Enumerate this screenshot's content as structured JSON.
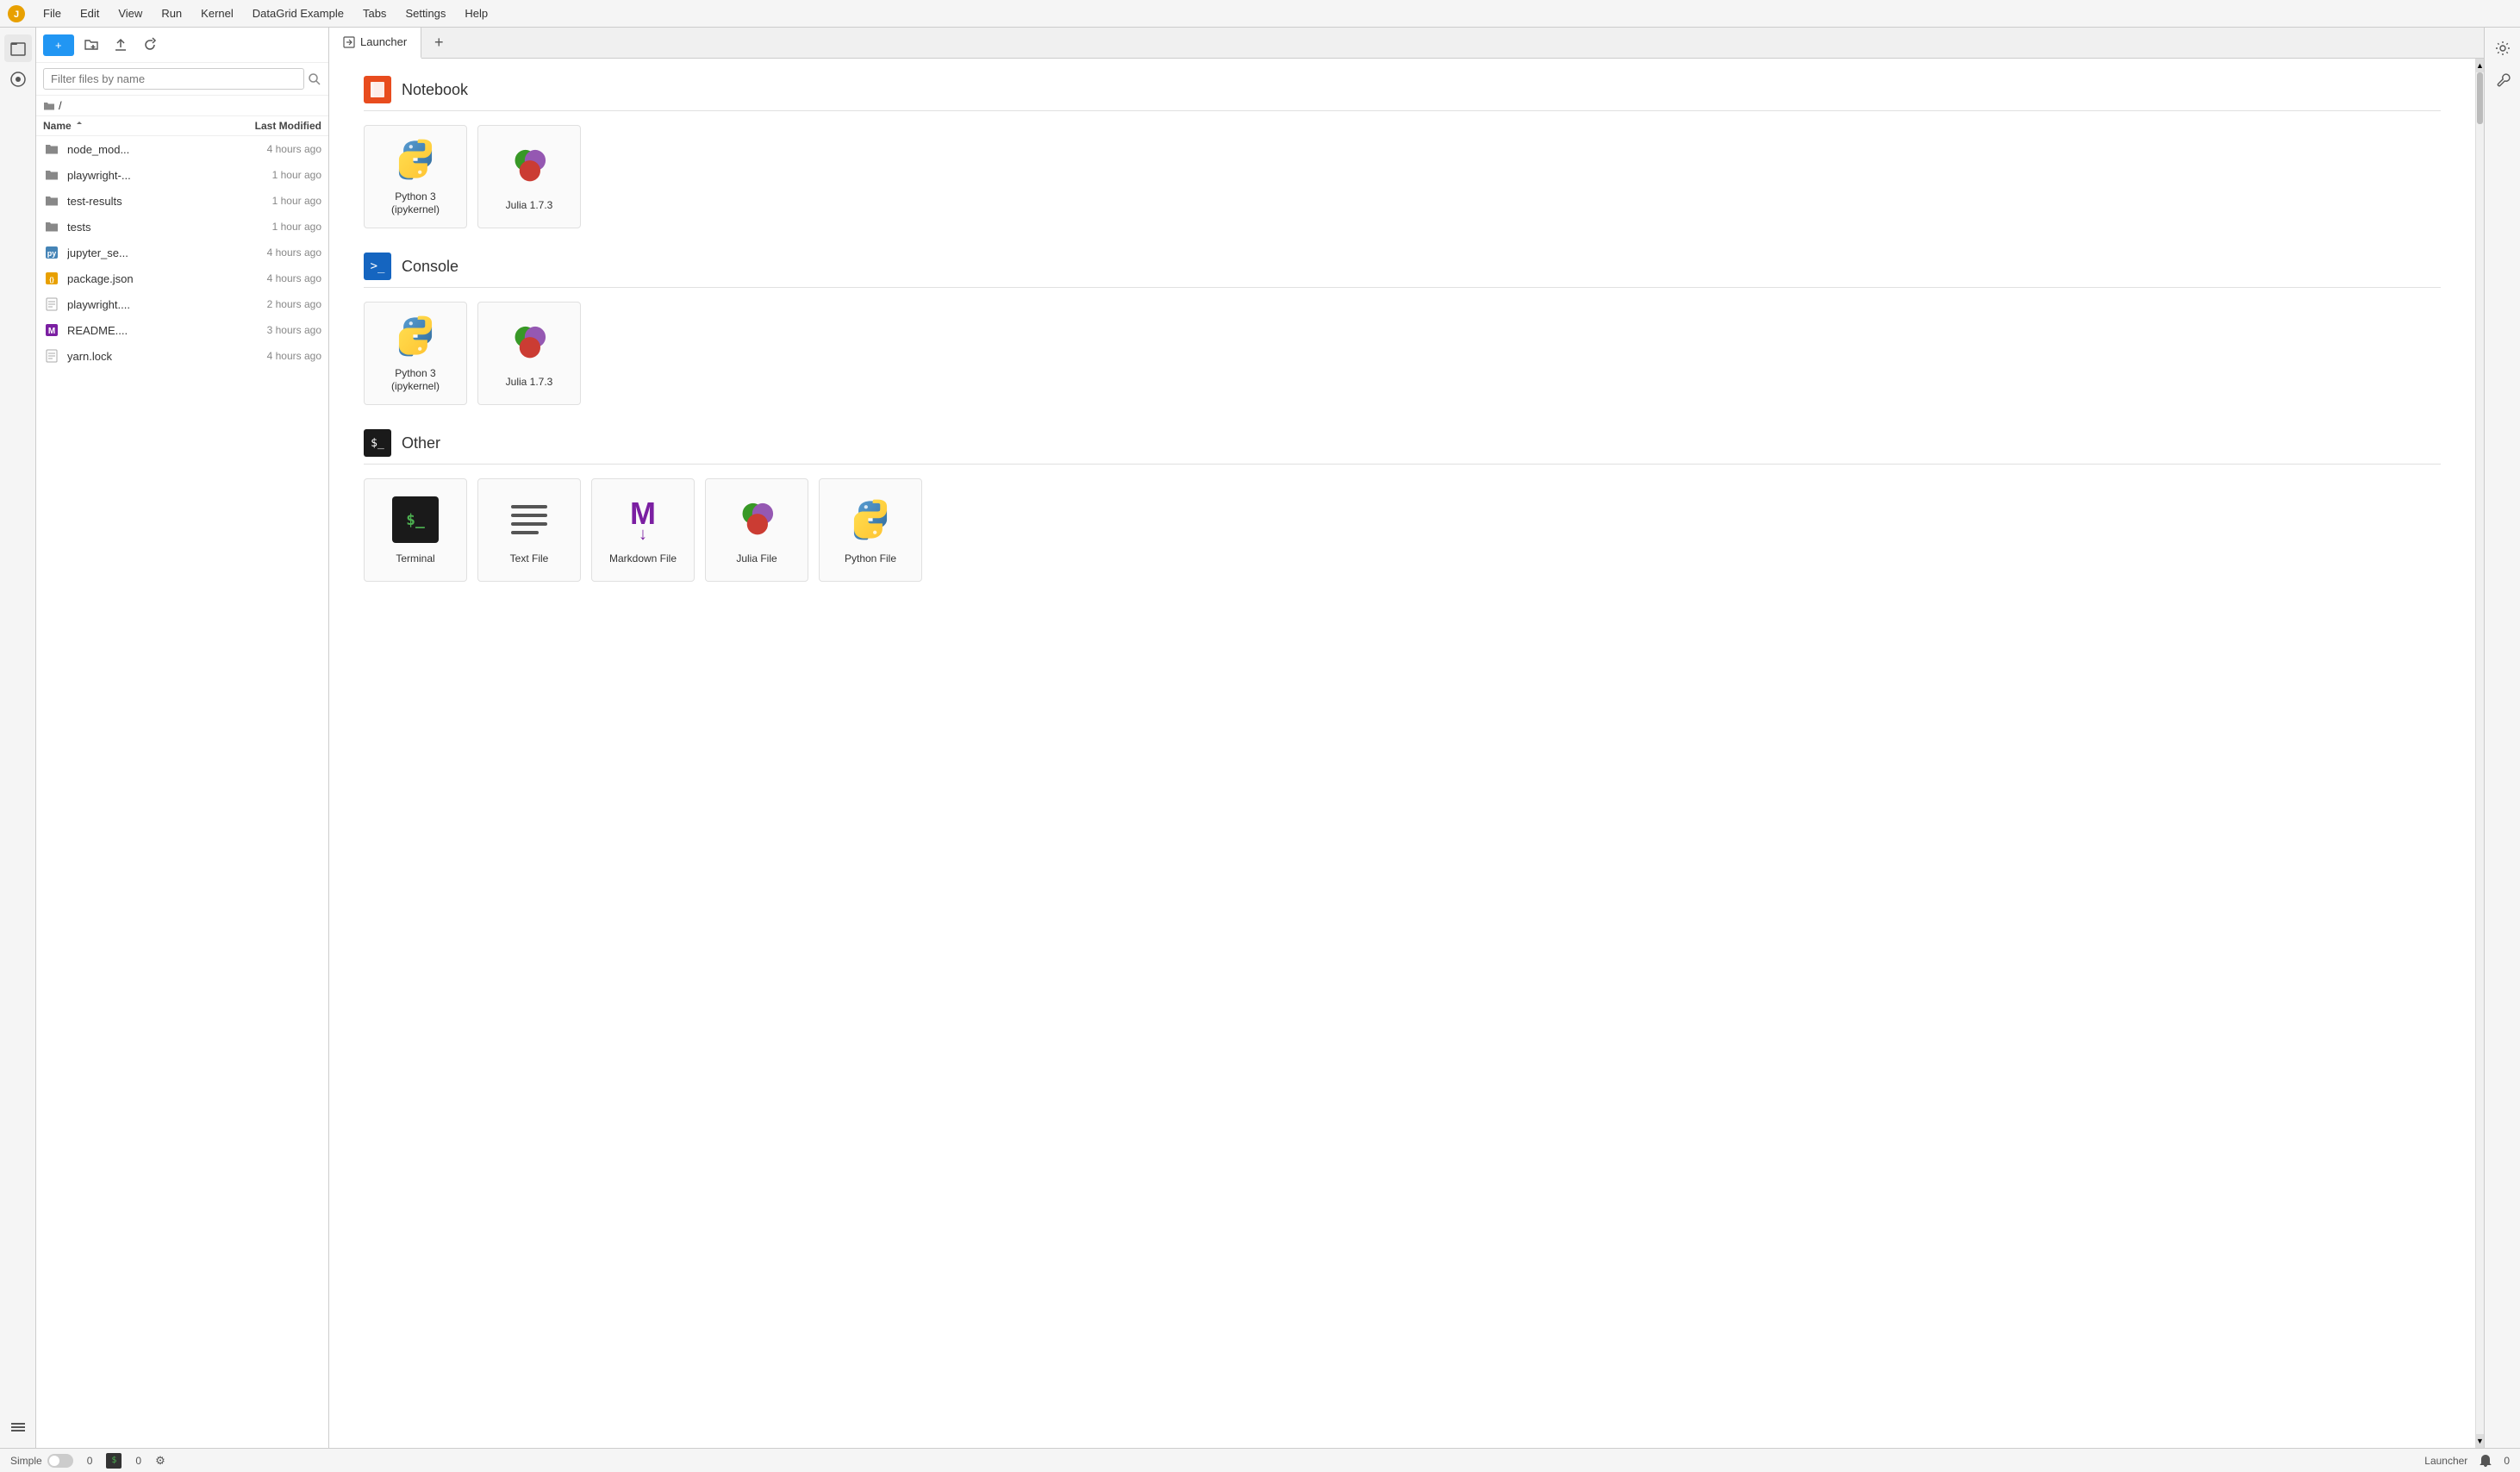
{
  "menubar": {
    "items": [
      "File",
      "Edit",
      "View",
      "Run",
      "Kernel",
      "DataGrid Example",
      "Tabs",
      "Settings",
      "Help"
    ]
  },
  "sidebar": {
    "icons": [
      {
        "name": "files-icon",
        "symbol": "📁",
        "active": true
      },
      {
        "name": "running-icon",
        "symbol": "⏺"
      },
      {
        "name": "commands-icon",
        "symbol": "≡"
      }
    ]
  },
  "file_panel": {
    "new_button": "+",
    "search_placeholder": "Filter files by name",
    "breadcrumb": "/",
    "columns": {
      "name": "Name",
      "modified": "Last Modified"
    },
    "files": [
      {
        "name": "node_mod...",
        "type": "folder",
        "modified": "4 hours ago"
      },
      {
        "name": "playwright-...",
        "type": "folder",
        "modified": "1 hour ago"
      },
      {
        "name": "test-results",
        "type": "folder",
        "modified": "1 hour ago"
      },
      {
        "name": "tests",
        "type": "folder",
        "modified": "1 hour ago"
      },
      {
        "name": "jupyter_se...",
        "type": "python",
        "modified": "4 hours ago"
      },
      {
        "name": "package.json",
        "type": "json",
        "modified": "4 hours ago"
      },
      {
        "name": "playwright....",
        "type": "file",
        "modified": "2 hours ago"
      },
      {
        "name": "README....",
        "type": "markdown",
        "modified": "3 hours ago"
      },
      {
        "name": "yarn.lock",
        "type": "file",
        "modified": "4 hours ago"
      }
    ]
  },
  "tabs": [
    {
      "label": "Launcher",
      "icon": "launch",
      "active": true
    }
  ],
  "launcher": {
    "sections": [
      {
        "id": "notebook",
        "title": "Notebook",
        "icon_text": "🔖",
        "icon_type": "notebook",
        "cards": [
          {
            "label": "Python 3\n(ipykernel)",
            "type": "python"
          },
          {
            "label": "Julia 1.7.3",
            "type": "julia"
          }
        ]
      },
      {
        "id": "console",
        "title": "Console",
        "icon_text": ">_",
        "icon_type": "console",
        "cards": [
          {
            "label": "Python 3\n(ipykernel)",
            "type": "python"
          },
          {
            "label": "Julia 1.7.3",
            "type": "julia"
          }
        ]
      },
      {
        "id": "other",
        "title": "Other",
        "icon_text": "$_",
        "icon_type": "other",
        "cards": [
          {
            "label": "Terminal",
            "type": "terminal"
          },
          {
            "label": "Text File",
            "type": "text"
          },
          {
            "label": "Markdown File",
            "type": "markdown"
          },
          {
            "label": "Julia File",
            "type": "julia-file"
          },
          {
            "label": "Python File",
            "type": "python-file"
          }
        ]
      }
    ]
  },
  "status_bar": {
    "mode": "Simple",
    "count1": "0",
    "count2": "0",
    "active_tab": "Launcher",
    "notifications": "0"
  },
  "right_sidebar": {
    "icons": [
      {
        "name": "settings-icon",
        "symbol": "⚙"
      },
      {
        "name": "wrench-icon",
        "symbol": "🔧"
      }
    ]
  }
}
